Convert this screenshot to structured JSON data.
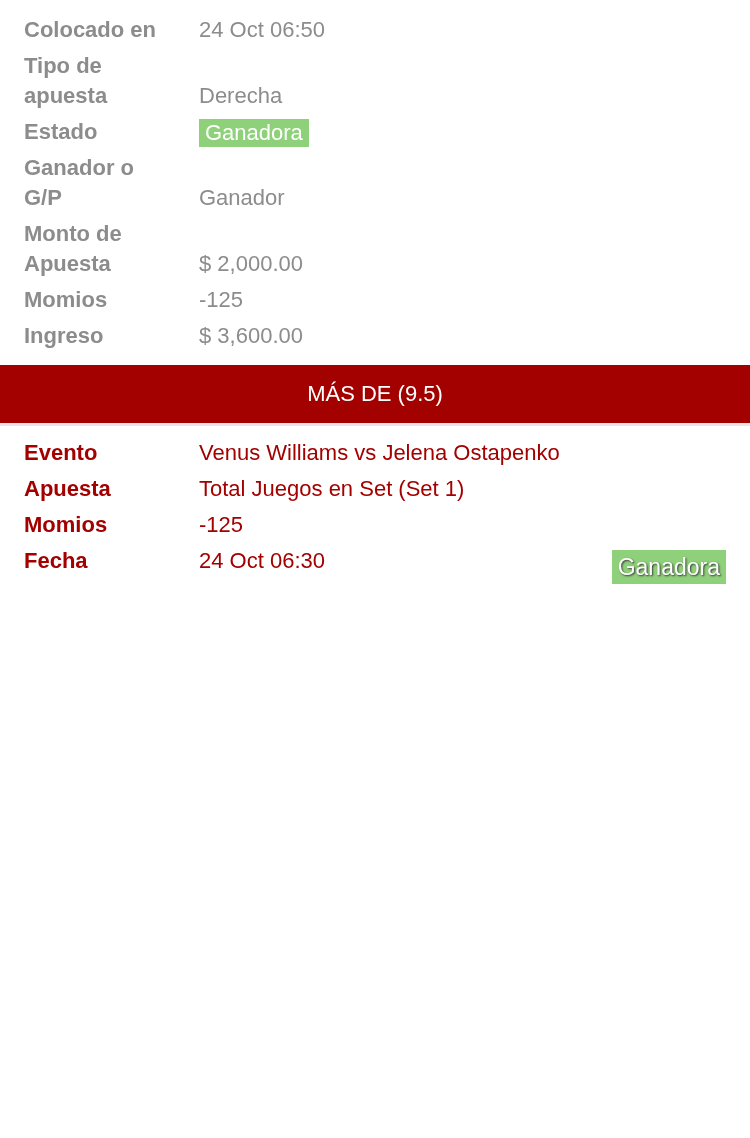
{
  "details": {
    "rows": [
      {
        "label": "Colocado en",
        "value": "24 Oct 06:50",
        "kind": "text"
      },
      {
        "label": "Tipo de apuesta",
        "value": "Derecha",
        "kind": "text"
      },
      {
        "label": "Estado",
        "value": "Ganadora",
        "kind": "badge"
      },
      {
        "label": "Ganador o G/P",
        "value": "Ganador",
        "kind": "text"
      },
      {
        "label": "Monto de Apuesta",
        "value": "$ 2,000.00",
        "kind": "text"
      },
      {
        "label": "Momios",
        "value": "-125",
        "kind": "text"
      },
      {
        "label": "Ingreso",
        "value": "$ 3,600.00",
        "kind": "text"
      }
    ]
  },
  "selection": {
    "title": "MÁS DE (9.5)",
    "rows": [
      {
        "label": "Evento",
        "value": "Venus Williams vs Jelena Ostapenko"
      },
      {
        "label": "Apuesta",
        "value": "Total Juegos en Set (Set 1)"
      },
      {
        "label": "Momios",
        "value": "-125"
      },
      {
        "label": "Fecha",
        "value": "24 Oct 06:30"
      }
    ],
    "status": "Ganadora"
  }
}
